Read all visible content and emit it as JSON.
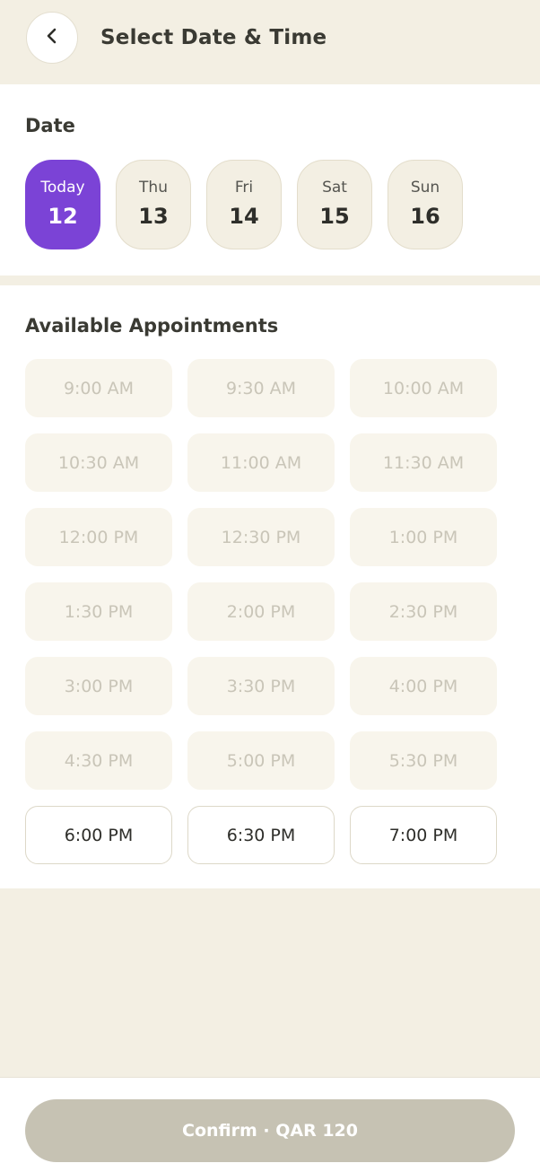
{
  "header": {
    "title": "Select Date & Time",
    "back_icon": "chevron-left-icon"
  },
  "date_section": {
    "label": "Date",
    "selected_index": 0,
    "dates": [
      {
        "day": "Today",
        "num": "12"
      },
      {
        "day": "Thu",
        "num": "13"
      },
      {
        "day": "Fri",
        "num": "14"
      },
      {
        "day": "Sat",
        "num": "15"
      },
      {
        "day": "Sun",
        "num": "16"
      }
    ]
  },
  "appointments": {
    "label": "Available Appointments",
    "slots": [
      {
        "time": "9:00 AM",
        "available": false
      },
      {
        "time": "9:30 AM",
        "available": false
      },
      {
        "time": "10:00 AM",
        "available": false
      },
      {
        "time": "10:30 AM",
        "available": false
      },
      {
        "time": "11:00 AM",
        "available": false
      },
      {
        "time": "11:30 AM",
        "available": false
      },
      {
        "time": "12:00 PM",
        "available": false
      },
      {
        "time": "12:30 PM",
        "available": false
      },
      {
        "time": "1:00 PM",
        "available": false
      },
      {
        "time": "1:30 PM",
        "available": false
      },
      {
        "time": "2:00 PM",
        "available": false
      },
      {
        "time": "2:30 PM",
        "available": false
      },
      {
        "time": "3:00 PM",
        "available": false
      },
      {
        "time": "3:30 PM",
        "available": false
      },
      {
        "time": "4:00 PM",
        "available": false
      },
      {
        "time": "4:30 PM",
        "available": false
      },
      {
        "time": "5:00 PM",
        "available": false
      },
      {
        "time": "5:30 PM",
        "available": false
      },
      {
        "time": "6:00 PM",
        "available": true
      },
      {
        "time": "6:30 PM",
        "available": true
      },
      {
        "time": "7:00 PM",
        "available": true
      }
    ]
  },
  "footer": {
    "confirm_label": "Confirm · QAR 120"
  },
  "colors": {
    "accent": "#7b43d6",
    "background": "#f3efe3",
    "disabled_button": "#c6c2b3"
  }
}
